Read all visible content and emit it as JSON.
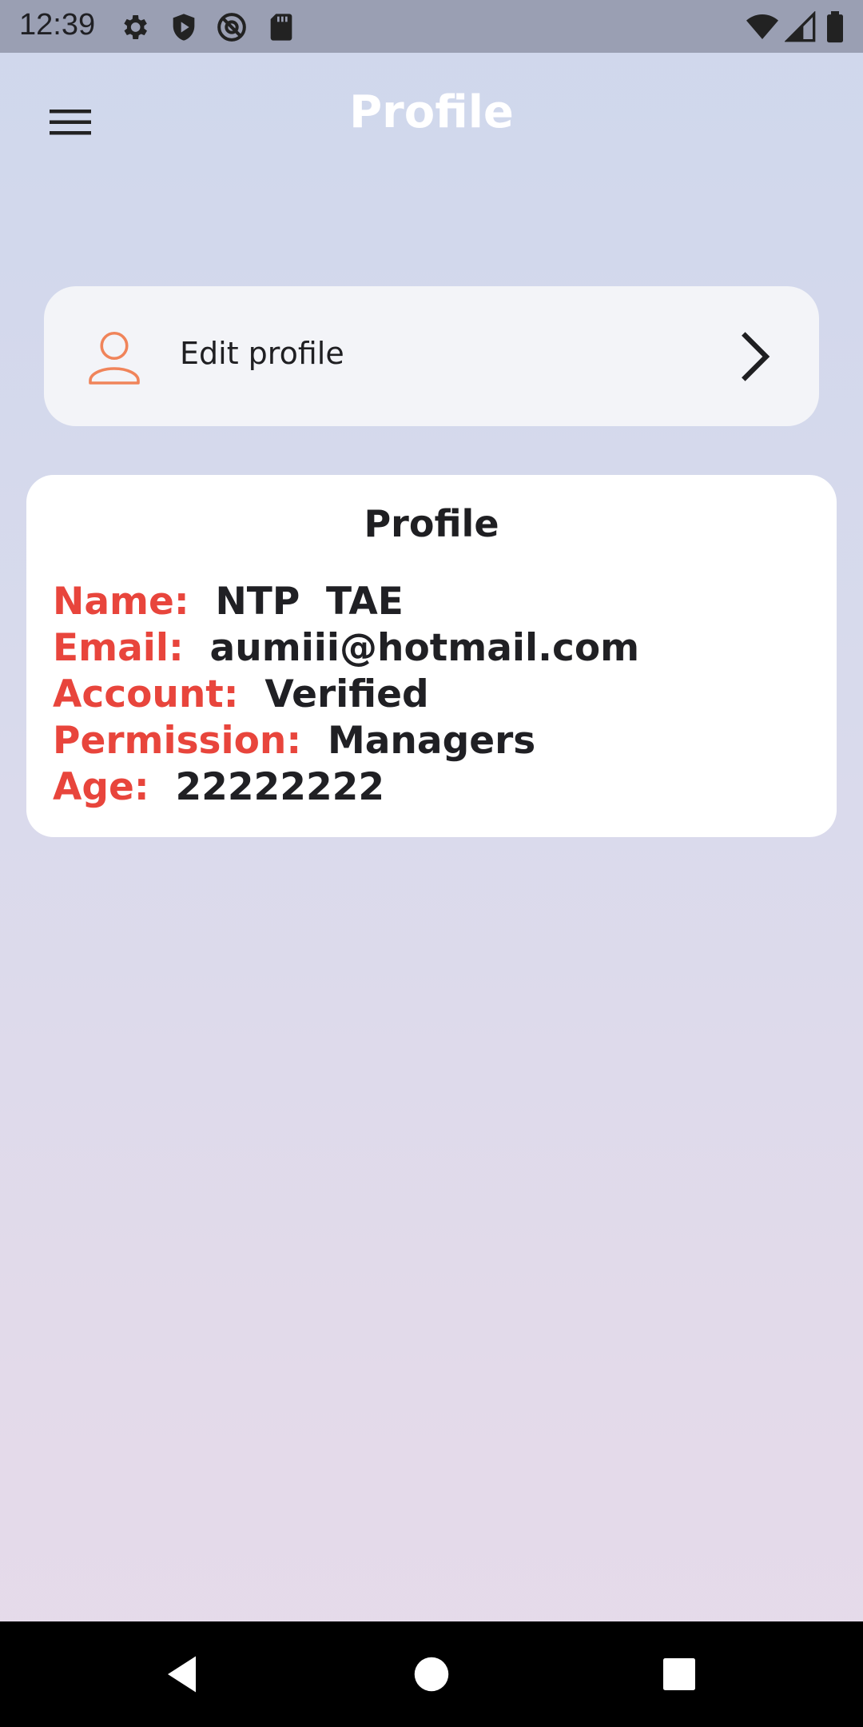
{
  "status_bar": {
    "time": "12:39",
    "left_icons": [
      "settings-icon",
      "shield-icon",
      "at-sign-icon",
      "sd-card-icon"
    ],
    "right_icons": [
      "wifi-icon",
      "signal-icon",
      "battery-icon"
    ]
  },
  "app_bar": {
    "title": "Profile",
    "menu_icon": "menu-icon"
  },
  "edit_profile": {
    "label": "Edit profile",
    "icon": "person-icon",
    "chevron": "chevron-right-icon",
    "icon_color": "#f0845a"
  },
  "profile_card": {
    "title": "Profile",
    "rows": [
      {
        "key": "Name:",
        "value": "NTP  TAE"
      },
      {
        "key": "Email:",
        "value": "aumiii@hotmail.com"
      },
      {
        "key": "Account:",
        "value": "Verified"
      },
      {
        "key": "Permission:",
        "value": "Managers"
      },
      {
        "key": "Age:",
        "value": "22222222"
      }
    ],
    "key_color": "#e8453c"
  },
  "nav_bar": {
    "buttons": [
      "back-icon",
      "home-icon",
      "recents-icon"
    ]
  }
}
